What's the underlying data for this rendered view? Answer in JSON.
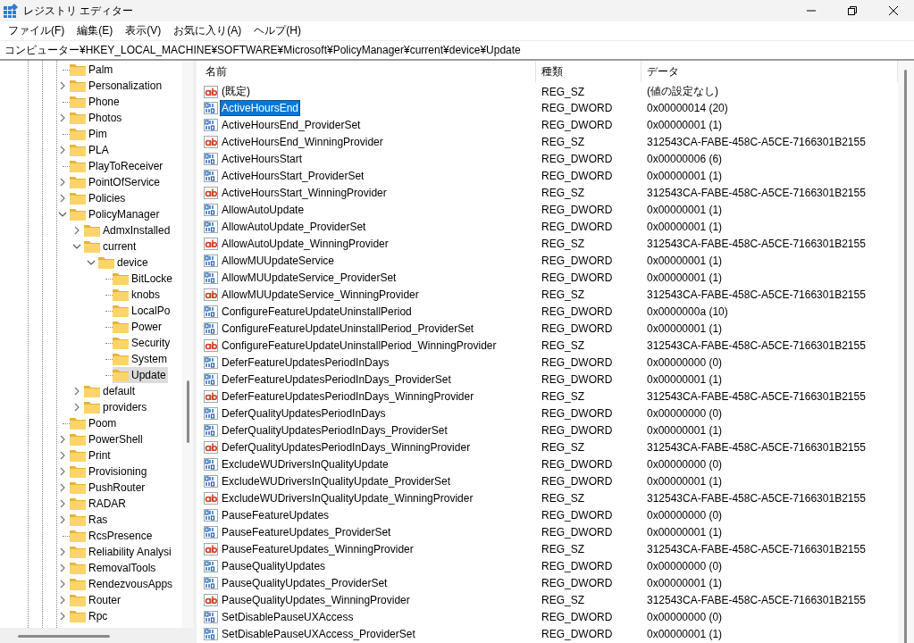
{
  "window": {
    "title": "レジストリ エディター"
  },
  "menu": [
    "ファイル(F)",
    "編集(E)",
    "表示(V)",
    "お気に入り(A)",
    "ヘルプ(H)"
  ],
  "address": "コンピューター¥HKEY_LOCAL_MACHINE¥SOFTWARE¥Microsoft¥PolicyManager¥current¥device¥Update",
  "tree": [
    {
      "label": "Palm",
      "kind": "leaf",
      "selected": false
    },
    {
      "label": "Personalization",
      "kind": "folder",
      "expanded": false,
      "selected": false
    },
    {
      "label": "Phone",
      "kind": "leaf",
      "selected": false
    },
    {
      "label": "Photos",
      "kind": "folder",
      "expanded": false,
      "selected": false
    },
    {
      "label": "Pim",
      "kind": "leaf",
      "selected": false
    },
    {
      "label": "PLA",
      "kind": "folder",
      "expanded": false,
      "selected": false
    },
    {
      "label": "PlayToReceiver",
      "kind": "leaf",
      "selected": false
    },
    {
      "label": "PointOfService",
      "kind": "folder",
      "expanded": false,
      "selected": false
    },
    {
      "label": "Policies",
      "kind": "folder",
      "expanded": false,
      "selected": false
    },
    {
      "label": "PolicyManager",
      "kind": "folder",
      "expanded": true,
      "selected": false,
      "children": [
        {
          "label": "AdmxInstalled",
          "kind": "folder",
          "expanded": false,
          "selected": false
        },
        {
          "label": "current",
          "kind": "folder",
          "expanded": true,
          "selected": false,
          "children": [
            {
              "label": "device",
              "kind": "folder",
              "expanded": true,
              "selected": false,
              "children": [
                {
                  "label": "BitLocke",
                  "kind": "leaf",
                  "selected": false
                },
                {
                  "label": "knobs",
                  "kind": "leaf",
                  "selected": false
                },
                {
                  "label": "LocalPo",
                  "kind": "leaf",
                  "selected": false
                },
                {
                  "label": "Power",
                  "kind": "leaf",
                  "selected": false
                },
                {
                  "label": "Security",
                  "kind": "leaf",
                  "selected": false
                },
                {
                  "label": "System",
                  "kind": "leaf",
                  "selected": false
                },
                {
                  "label": "Update",
                  "kind": "leaf",
                  "selected": true
                }
              ]
            }
          ]
        },
        {
          "label": "default",
          "kind": "folder",
          "expanded": false,
          "selected": false
        },
        {
          "label": "providers",
          "kind": "folder",
          "expanded": false,
          "selected": false
        }
      ]
    },
    {
      "label": "Poom",
      "kind": "leaf",
      "selected": false
    },
    {
      "label": "PowerShell",
      "kind": "folder",
      "expanded": false,
      "selected": false
    },
    {
      "label": "Print",
      "kind": "folder",
      "expanded": false,
      "selected": false
    },
    {
      "label": "Provisioning",
      "kind": "folder",
      "expanded": false,
      "selected": false
    },
    {
      "label": "PushRouter",
      "kind": "folder",
      "expanded": false,
      "selected": false
    },
    {
      "label": "RADAR",
      "kind": "folder",
      "expanded": false,
      "selected": false
    },
    {
      "label": "Ras",
      "kind": "folder",
      "expanded": false,
      "selected": false
    },
    {
      "label": "RcsPresence",
      "kind": "leaf",
      "selected": false
    },
    {
      "label": "Reliability Analysi",
      "kind": "folder",
      "expanded": false,
      "selected": false
    },
    {
      "label": "RemovalTools",
      "kind": "folder",
      "expanded": false,
      "selected": false
    },
    {
      "label": "RendezvousApps",
      "kind": "folder",
      "expanded": false,
      "selected": false
    },
    {
      "label": "Router",
      "kind": "folder",
      "expanded": false,
      "selected": false
    },
    {
      "label": "Rpc",
      "kind": "folder",
      "expanded": false,
      "selected": false
    }
  ],
  "table": {
    "columns": [
      "名前",
      "種類",
      "データ"
    ],
    "rows": [
      {
        "kind": "string",
        "name": "(既定)",
        "type": "REG_SZ",
        "data": "(値の設定なし)",
        "selected": false
      },
      {
        "kind": "binary",
        "name": "ActiveHoursEnd",
        "type": "REG_DWORD",
        "data": "0x00000014 (20)",
        "selected": true
      },
      {
        "kind": "binary",
        "name": "ActiveHoursEnd_ProviderSet",
        "type": "REG_DWORD",
        "data": "0x00000001 (1)",
        "selected": false
      },
      {
        "kind": "string",
        "name": "ActiveHoursEnd_WinningProvider",
        "type": "REG_SZ",
        "data": "312543CA-FABE-458C-A5CE-7166301B2155",
        "selected": false
      },
      {
        "kind": "binary",
        "name": "ActiveHoursStart",
        "type": "REG_DWORD",
        "data": "0x00000006 (6)",
        "selected": false
      },
      {
        "kind": "binary",
        "name": "ActiveHoursStart_ProviderSet",
        "type": "REG_DWORD",
        "data": "0x00000001 (1)",
        "selected": false
      },
      {
        "kind": "string",
        "name": "ActiveHoursStart_WinningProvider",
        "type": "REG_SZ",
        "data": "312543CA-FABE-458C-A5CE-7166301B2155",
        "selected": false
      },
      {
        "kind": "binary",
        "name": "AllowAutoUpdate",
        "type": "REG_DWORD",
        "data": "0x00000001 (1)",
        "selected": false
      },
      {
        "kind": "binary",
        "name": "AllowAutoUpdate_ProviderSet",
        "type": "REG_DWORD",
        "data": "0x00000001 (1)",
        "selected": false
      },
      {
        "kind": "string",
        "name": "AllowAutoUpdate_WinningProvider",
        "type": "REG_SZ",
        "data": "312543CA-FABE-458C-A5CE-7166301B2155",
        "selected": false
      },
      {
        "kind": "binary",
        "name": "AllowMUUpdateService",
        "type": "REG_DWORD",
        "data": "0x00000001 (1)",
        "selected": false
      },
      {
        "kind": "binary",
        "name": "AllowMUUpdateService_ProviderSet",
        "type": "REG_DWORD",
        "data": "0x00000001 (1)",
        "selected": false
      },
      {
        "kind": "string",
        "name": "AllowMUUpdateService_WinningProvider",
        "type": "REG_SZ",
        "data": "312543CA-FABE-458C-A5CE-7166301B2155",
        "selected": false
      },
      {
        "kind": "binary",
        "name": "ConfigureFeatureUpdateUninstallPeriod",
        "type": "REG_DWORD",
        "data": "0x0000000a (10)",
        "selected": false
      },
      {
        "kind": "binary",
        "name": "ConfigureFeatureUpdateUninstallPeriod_ProviderSet",
        "type": "REG_DWORD",
        "data": "0x00000001 (1)",
        "selected": false
      },
      {
        "kind": "string",
        "name": "ConfigureFeatureUpdateUninstallPeriod_WinningProvider",
        "type": "REG_SZ",
        "data": "312543CA-FABE-458C-A5CE-7166301B2155",
        "selected": false
      },
      {
        "kind": "binary",
        "name": "DeferFeatureUpdatesPeriodInDays",
        "type": "REG_DWORD",
        "data": "0x00000000 (0)",
        "selected": false
      },
      {
        "kind": "binary",
        "name": "DeferFeatureUpdatesPeriodInDays_ProviderSet",
        "type": "REG_DWORD",
        "data": "0x00000001 (1)",
        "selected": false
      },
      {
        "kind": "string",
        "name": "DeferFeatureUpdatesPeriodInDays_WinningProvider",
        "type": "REG_SZ",
        "data": "312543CA-FABE-458C-A5CE-7166301B2155",
        "selected": false
      },
      {
        "kind": "binary",
        "name": "DeferQualityUpdatesPeriodInDays",
        "type": "REG_DWORD",
        "data": "0x00000000 (0)",
        "selected": false
      },
      {
        "kind": "binary",
        "name": "DeferQualityUpdatesPeriodInDays_ProviderSet",
        "type": "REG_DWORD",
        "data": "0x00000001 (1)",
        "selected": false
      },
      {
        "kind": "string",
        "name": "DeferQualityUpdatesPeriodInDays_WinningProvider",
        "type": "REG_SZ",
        "data": "312543CA-FABE-458C-A5CE-7166301B2155",
        "selected": false
      },
      {
        "kind": "binary",
        "name": "ExcludeWUDriversInQualityUpdate",
        "type": "REG_DWORD",
        "data": "0x00000000 (0)",
        "selected": false
      },
      {
        "kind": "binary",
        "name": "ExcludeWUDriversInQualityUpdate_ProviderSet",
        "type": "REG_DWORD",
        "data": "0x00000001 (1)",
        "selected": false
      },
      {
        "kind": "string",
        "name": "ExcludeWUDriversInQualityUpdate_WinningProvider",
        "type": "REG_SZ",
        "data": "312543CA-FABE-458C-A5CE-7166301B2155",
        "selected": false
      },
      {
        "kind": "binary",
        "name": "PauseFeatureUpdates",
        "type": "REG_DWORD",
        "data": "0x00000000 (0)",
        "selected": false
      },
      {
        "kind": "binary",
        "name": "PauseFeatureUpdates_ProviderSet",
        "type": "REG_DWORD",
        "data": "0x00000001 (1)",
        "selected": false
      },
      {
        "kind": "string",
        "name": "PauseFeatureUpdates_WinningProvider",
        "type": "REG_SZ",
        "data": "312543CA-FABE-458C-A5CE-7166301B2155",
        "selected": false
      },
      {
        "kind": "binary",
        "name": "PauseQualityUpdates",
        "type": "REG_DWORD",
        "data": "0x00000000 (0)",
        "selected": false
      },
      {
        "kind": "binary",
        "name": "PauseQualityUpdates_ProviderSet",
        "type": "REG_DWORD",
        "data": "0x00000001 (1)",
        "selected": false
      },
      {
        "kind": "string",
        "name": "PauseQualityUpdates_WinningProvider",
        "type": "REG_SZ",
        "data": "312543CA-FABE-458C-A5CE-7166301B2155",
        "selected": false
      },
      {
        "kind": "binary",
        "name": "SetDisablePauseUXAccess",
        "type": "REG_DWORD",
        "data": "0x00000000 (0)",
        "selected": false
      },
      {
        "kind": "binary",
        "name": "SetDisablePauseUXAccess_ProviderSet",
        "type": "REG_DWORD",
        "data": "0x00000001 (1)",
        "selected": false
      }
    ]
  }
}
